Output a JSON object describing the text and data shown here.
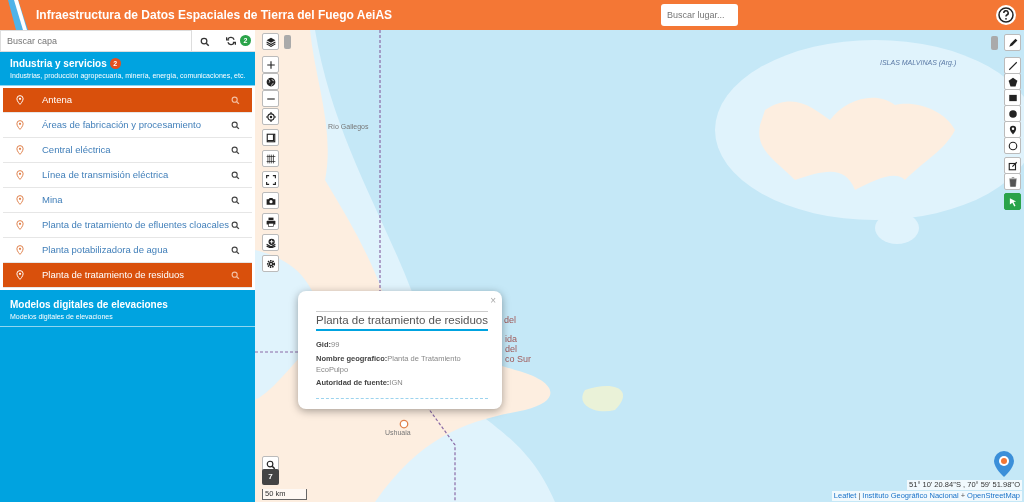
{
  "header": {
    "title": "Infraestructura de Datos Espaciales de Tierra del Fuego AeiAS",
    "search_placeholder": "Buscar lugar..."
  },
  "sidebar": {
    "search_placeholder": "Buscar capa",
    "refresh_badge": "2",
    "categories": [
      {
        "title": "Industria y servicios",
        "badge": "2",
        "subtitle": "Industrias, producción agropecuaria, minería, energía, comunicaciones, etc.",
        "expanded": true,
        "items": [
          {
            "label": "Antena",
            "selected": true
          },
          {
            "label": "Áreas de fabricación y procesamiento",
            "selected": false
          },
          {
            "label": "Central eléctrica",
            "selected": false
          },
          {
            "label": "Línea de transmisión eléctrica",
            "selected": false
          },
          {
            "label": "Mina",
            "selected": false
          },
          {
            "label": "Planta de tratamiento de efluentes cloacales",
            "selected": false
          },
          {
            "label": "Planta potabilizadora de agua",
            "selected": false
          },
          {
            "label": "Planta de tratamiento de residuos",
            "selected": true
          }
        ]
      },
      {
        "title": "Modelos digitales de elevaciones",
        "subtitle": "Modelos digitales de elevaciones",
        "expanded": false
      }
    ]
  },
  "map": {
    "labels": [
      {
        "text": "ISLAS MALVINAS (Arg.)",
        "kind": "region"
      },
      {
        "text": "Río Gallegos",
        "kind": "city"
      },
      {
        "text": "del",
        "kind": "partial"
      },
      {
        "text": "ida",
        "kind": "partial"
      },
      {
        "text": "del",
        "kind": "partial"
      },
      {
        "text": "co Sur",
        "kind": "partial"
      },
      {
        "text": "Ushuaia",
        "kind": "city"
      }
    ],
    "popup": {
      "title": "Planta de tratamiento de residuos",
      "close": "×",
      "fields": [
        "**Gid:**99",
        "**Nombre geografico:**Planta de Tratamiento EcoPulpo",
        "**Autoridad de fuente:**IGN"
      ]
    },
    "zoom_level": "7",
    "scale": "50 km",
    "coordinates": "51° 10' 20.84''S , 70° 59' 51.98''O",
    "attribution": [
      {
        "text": "Leaflet",
        "kind": "link"
      },
      {
        "text": "|",
        "kind": "separator"
      },
      {
        "text": "Instituto Geográfico Nacional",
        "kind": "link"
      },
      {
        "text": "+",
        "kind": "separator"
      },
      {
        "text": "OpenStreetMap",
        "kind": "link"
      }
    ]
  }
}
